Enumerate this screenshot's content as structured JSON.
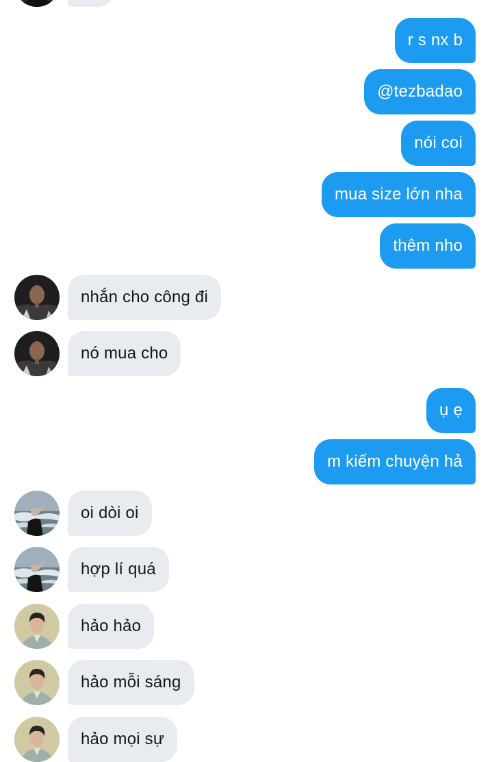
{
  "conversation": {
    "messages": [
      {
        "side": "out",
        "text": "r s nx b"
      },
      {
        "side": "out",
        "text": "@tezbadao"
      },
      {
        "side": "out",
        "text": "nói coi"
      },
      {
        "side": "out",
        "text": "mua size lớn nha"
      },
      {
        "side": "out",
        "text": "thêm nho"
      },
      {
        "side": "in",
        "text": "nhắn cho công đi",
        "avatar": "contact-a-avatar"
      },
      {
        "side": "in",
        "text": "nó mua cho",
        "avatar": "contact-a-avatar"
      },
      {
        "side": "out",
        "text": "ụ ẹ"
      },
      {
        "side": "out",
        "text": "m kiếm chuyện hả"
      },
      {
        "side": "in",
        "text": "oi dòi oi",
        "avatar": "contact-b-avatar"
      },
      {
        "side": "in",
        "text": "hợp lí quá",
        "avatar": "contact-b-avatar"
      },
      {
        "side": "in",
        "text": "hảo hảo",
        "avatar": "contact-c-avatar"
      },
      {
        "side": "in",
        "text": "hảo mỗi sáng",
        "avatar": "contact-c-avatar"
      },
      {
        "side": "in",
        "text": "hảo mọi sự",
        "avatar": "contact-c-avatar"
      }
    ]
  },
  "colors": {
    "outgoing_bubble": "#1d9bf0",
    "incoming_bubble": "#e8ecf0",
    "outgoing_text": "#ffffff",
    "incoming_text": "#14171a"
  }
}
